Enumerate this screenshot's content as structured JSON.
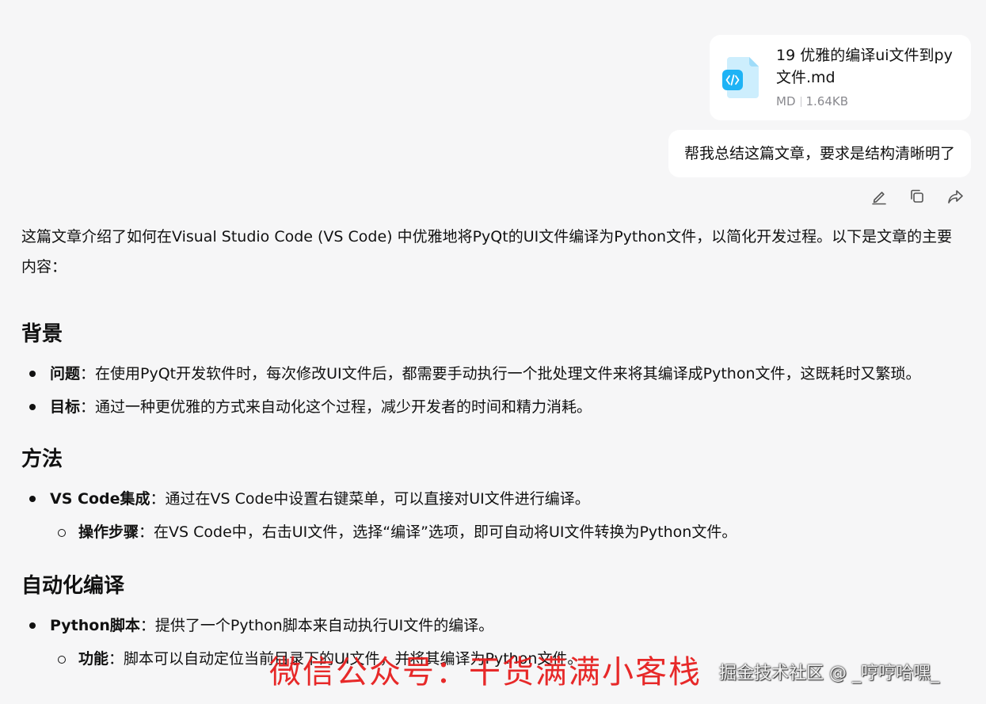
{
  "attachment": {
    "file_name": "19 优雅的编译ui文件到py文件.md",
    "file_type": "MD",
    "file_size": "1.64KB",
    "icon": "code-file-icon",
    "accent_color": "#1fb3f5"
  },
  "user_message": "帮我总结这篇文章，要求是结构清晰明了",
  "message_actions": {
    "icons": [
      "edit-icon",
      "copy-icon",
      "share-icon"
    ]
  },
  "answer": {
    "intro": "这篇文章介绍了如何在Visual Studio Code (VS Code) 中优雅地将PyQt的UI文件编译为Python文件，以简化开发过程。以下是文章的主要内容：",
    "sections": [
      {
        "title": "背景",
        "items": [
          {
            "term": "问题",
            "text": "：在使用PyQt开发软件时，每次修改UI文件后，都需要手动执行一个批处理文件来将其编译成Python文件，这既耗时又繁琐。"
          },
          {
            "term": "目标",
            "text": "：通过一种更优雅的方式来自动化这个过程，减少开发者的时间和精力消耗。"
          }
        ]
      },
      {
        "title": "方法",
        "items": [
          {
            "term": "VS Code集成",
            "text": "：通过在VS Code中设置右键菜单，可以直接对UI文件进行编译。",
            "sub": [
              {
                "term": "操作步骤",
                "text": "：在VS Code中，右击UI文件，选择“编译”选项，即可自动将UI文件转换为Python文件。"
              }
            ]
          }
        ]
      },
      {
        "title": "自动化编译",
        "items": [
          {
            "term": "Python脚本",
            "text": "：提供了一个Python脚本来自动执行UI文件的编译。",
            "sub": [
              {
                "term": "功能",
                "text": "：脚本可以自动定位当前目录下的UI文件，并将其编译为Python文件。"
              }
            ]
          }
        ]
      }
    ]
  },
  "watermarks": {
    "wechat": "微信公众号：干货满满小客栈",
    "juejin": "掘金技术社区 @ _哼哼哈嘿_"
  }
}
